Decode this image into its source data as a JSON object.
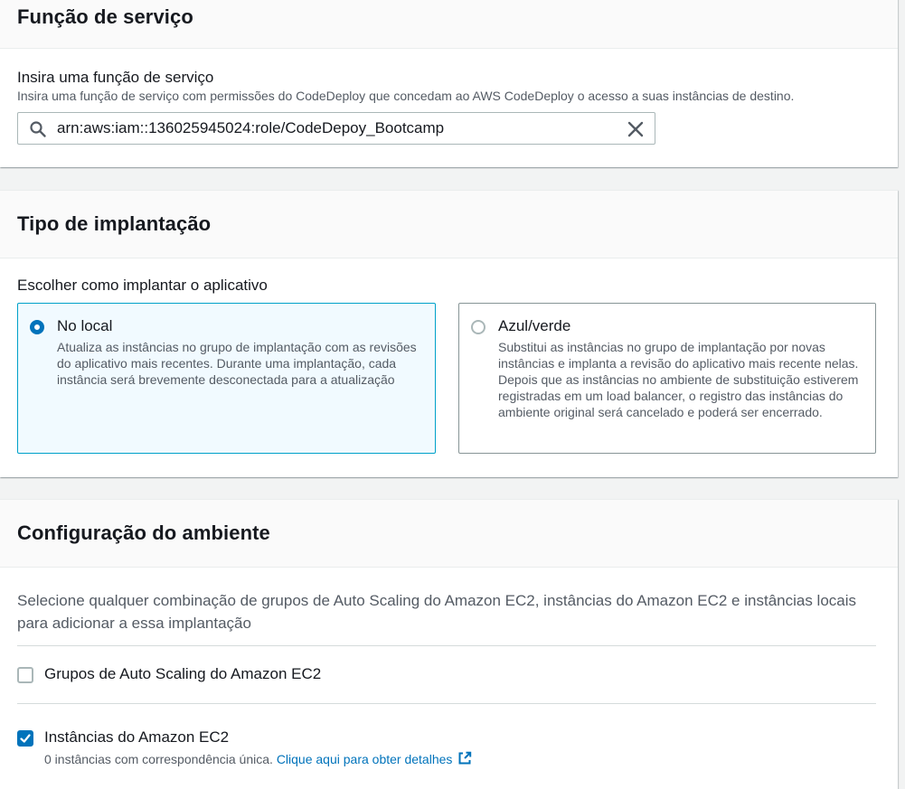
{
  "service_role": {
    "heading": "Função de serviço",
    "field_label": "Insira uma função de serviço",
    "field_description": "Insira uma função de serviço com permissões do CodeDeploy que concedam ao AWS CodeDeploy o acesso a suas instâncias de destino.",
    "value": "arn:aws:iam::136025945024:role/CodeDepoy_Bootcamp",
    "search_icon": "search-icon",
    "clear_icon": "close-icon"
  },
  "deployment_type": {
    "heading": "Tipo de implantação",
    "choose_label": "Escolher como implantar o aplicativo",
    "options": [
      {
        "title": "No local",
        "description": "Atualiza as instâncias no grupo de implantação com as revisões do aplicativo mais recentes. Durante uma implantação, cada instância será brevemente desconectada para a atualização",
        "selected": true
      },
      {
        "title": "Azul/verde",
        "description": "Substitui as instâncias no grupo de implantação por novas instâncias e implanta a revisão do aplicativo mais recente nelas. Depois que as instâncias no ambiente de substituição estiverem registradas em um load balancer, o registro das instâncias do ambiente original será cancelado e poderá ser encerrado.",
        "selected": false
      }
    ]
  },
  "environment": {
    "heading": "Configuração do ambiente",
    "description": "Selecione qualquer combinação de grupos de Auto Scaling do Amazon EC2, instâncias do Amazon EC2 e instâncias locais para adicionar a essa implantação",
    "options": [
      {
        "label": "Grupos de Auto Scaling do Amazon EC2",
        "checked": false
      },
      {
        "label": "Instâncias do Amazon EC2",
        "checked": true,
        "subtext": "0 instâncias com correspondência única.",
        "link": "Clique aqui para obter detalhes",
        "link_icon": "external-link-icon"
      }
    ]
  },
  "colors": {
    "accent": "#0073bb",
    "selected_border": "#00a1c9",
    "selected_bg": "#f1faff"
  }
}
